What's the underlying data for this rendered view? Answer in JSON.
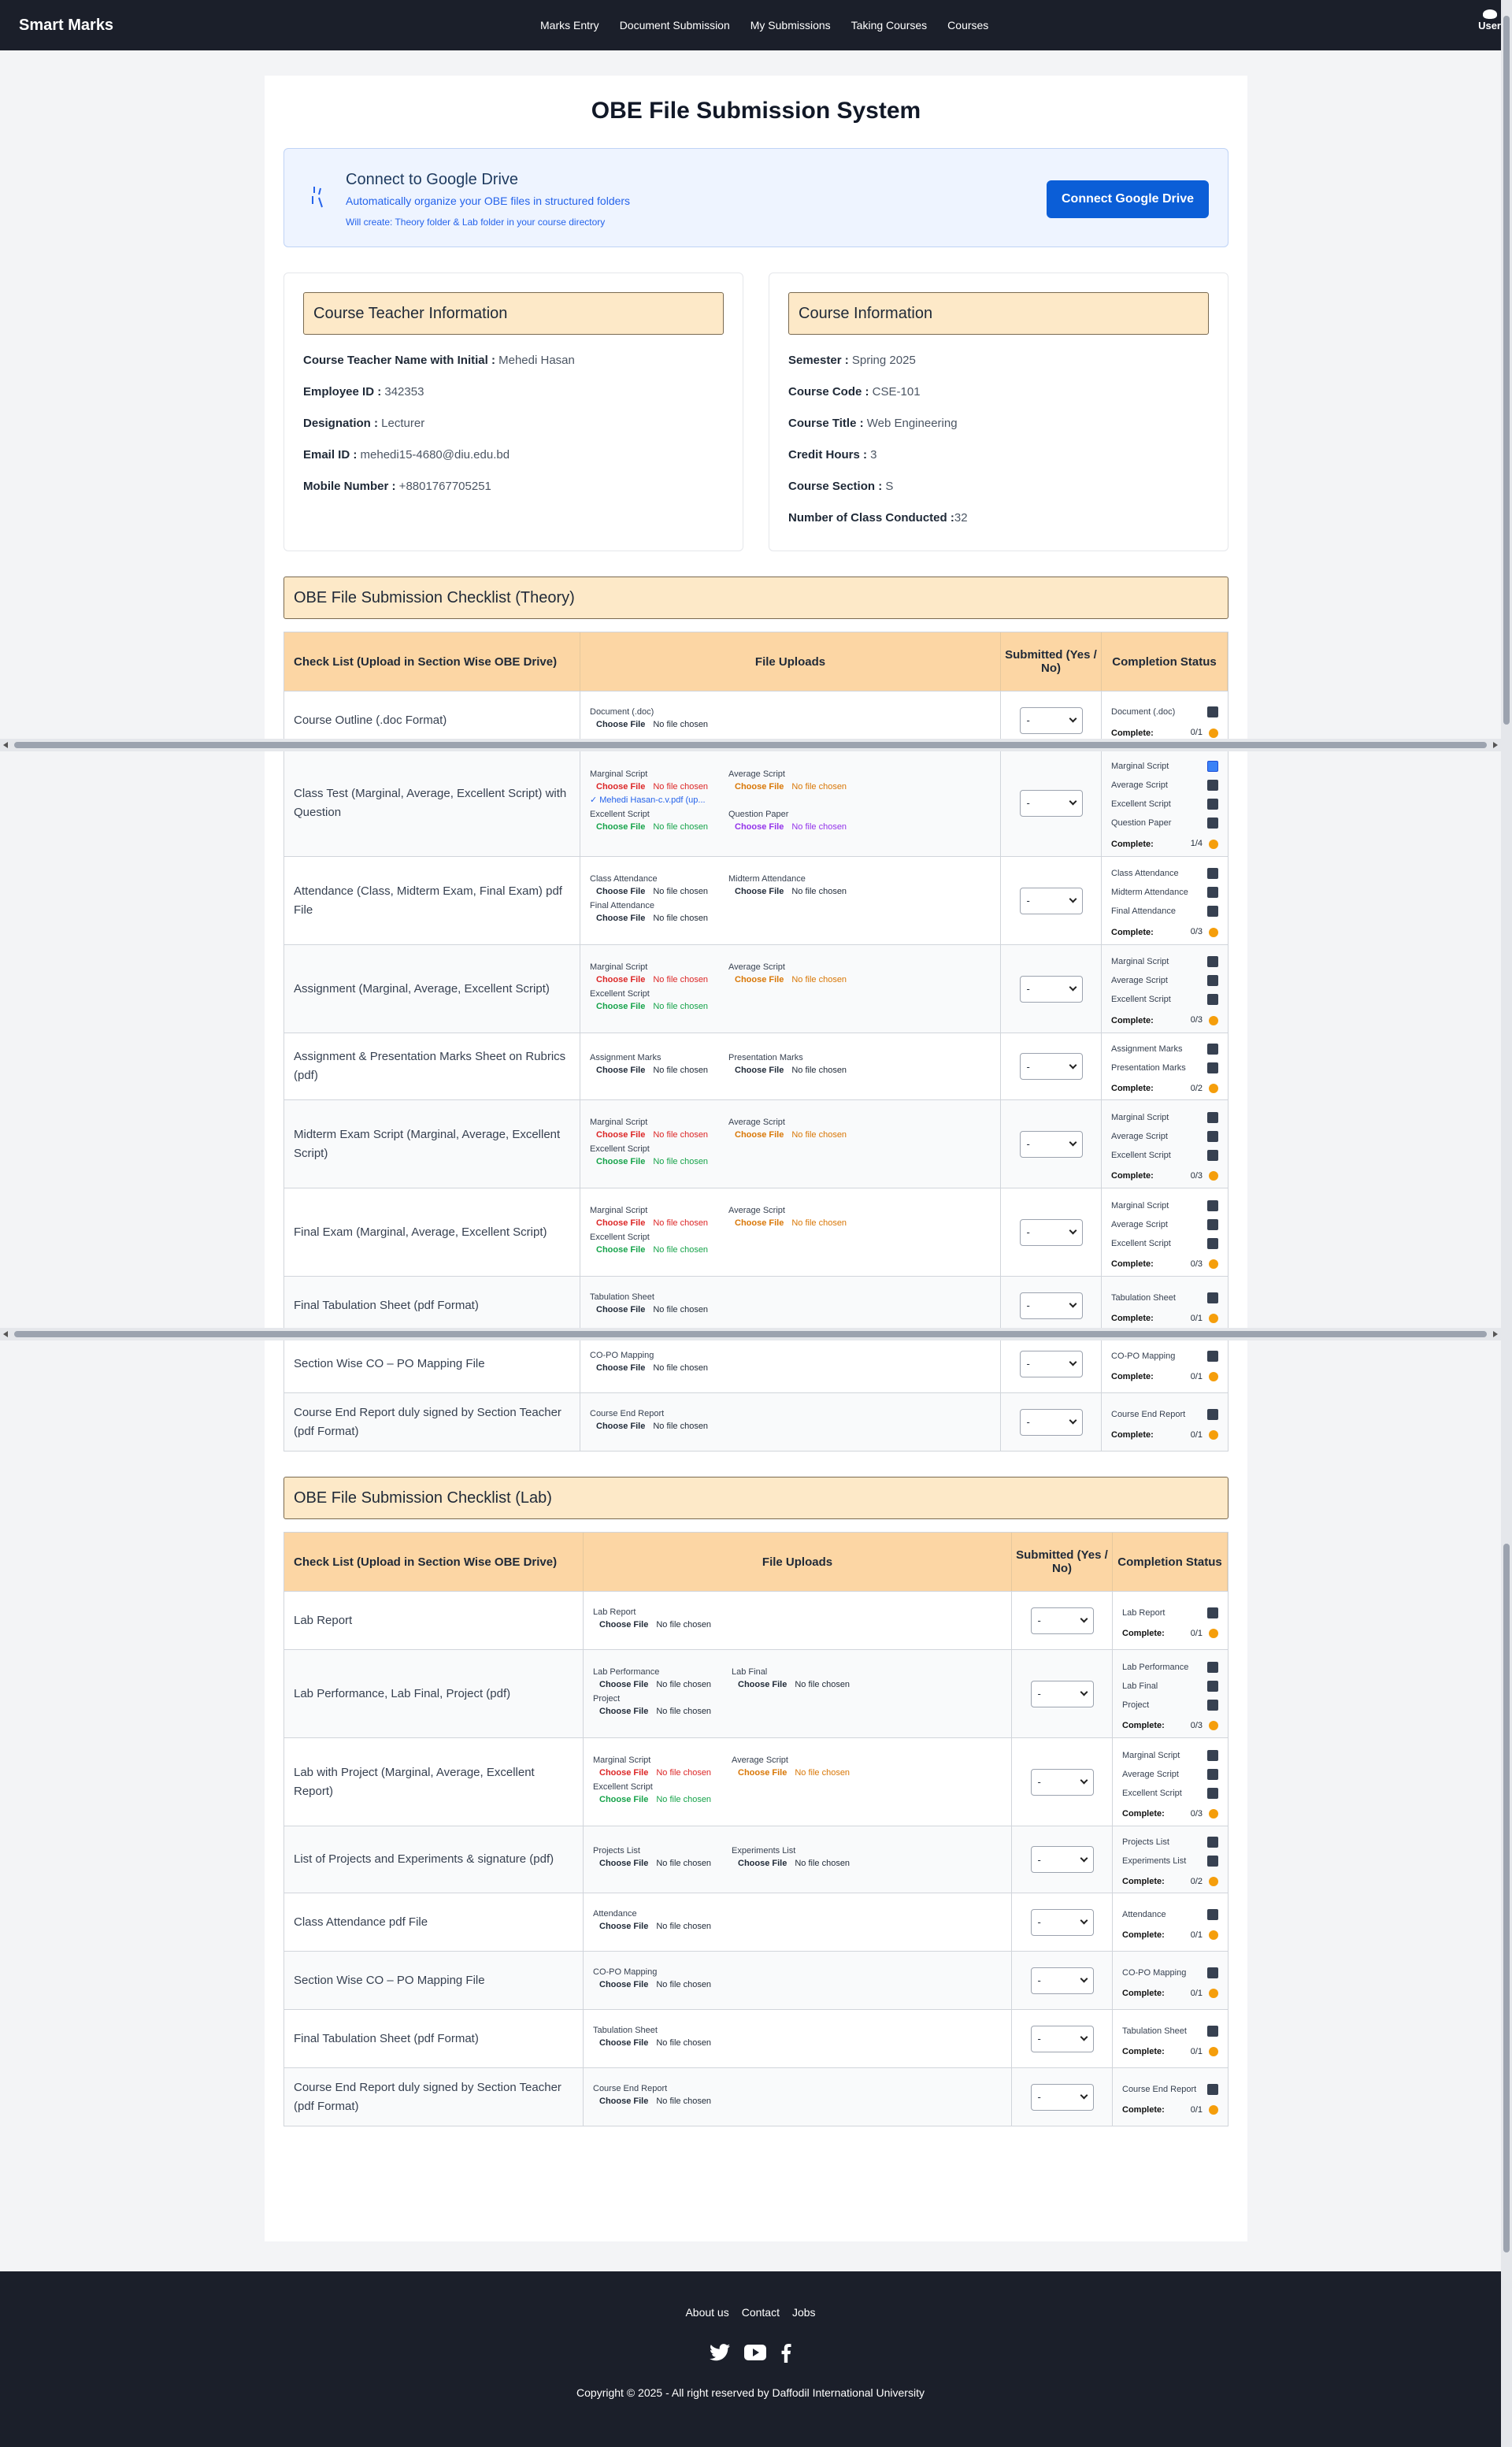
{
  "brand": "Smart Marks",
  "nav": [
    "Marks Entry",
    "Document Submission",
    "My Submissions",
    "Taking Courses",
    "Courses"
  ],
  "user": "User",
  "title": "OBE File Submission System",
  "gdrive": {
    "title": "Connect to Google Drive",
    "subtitle": "Automatically organize your OBE files in structured folders",
    "note": "Will create: Theory folder & Lab folder in your course directory",
    "button": "Connect Google Drive"
  },
  "teacher": {
    "heading": "Course Teacher Information",
    "rows": [
      {
        "label": "Course Teacher Name with Initial :",
        "value": " Mehedi Hasan"
      },
      {
        "label": "Employee ID :",
        "value": " 342353"
      },
      {
        "label": "Designation :",
        "value": " Lecturer"
      },
      {
        "label": "Email ID :",
        "value": " mehedi15-4680@diu.edu.bd"
      },
      {
        "label": "Mobile Number :",
        "value": " +8801767705251"
      }
    ]
  },
  "course": {
    "heading": "Course Information",
    "rows": [
      {
        "label": "Semester :",
        "value": " Spring 2025"
      },
      {
        "label": "Course Code :",
        "value": " CSE-101"
      },
      {
        "label": "Course Title :",
        "value": " Web Engineering"
      },
      {
        "label": "Credit Hours :",
        "value": " 3"
      },
      {
        "label": "Course Section :",
        "value": " S"
      },
      {
        "label": "Number of Class Conducted :",
        "value": "32"
      }
    ]
  },
  "theory": {
    "heading": "OBE File Submission Checklist (Theory)",
    "cols": [
      "Check List (Upload in Section Wise OBE Drive)",
      "File Uploads",
      "Submitted (Yes / No)",
      "Completion Status"
    ],
    "rows": [
      {
        "name": "Course Outline (.doc Format)",
        "files": [
          {
            "label": "Document (.doc)",
            "color": "blk"
          }
        ],
        "status": [
          {
            "label": "Document (.doc)",
            "on": false
          }
        ],
        "complete": "0/1"
      },
      {
        "name": "Class Test (Marginal, Average, Excellent Script) with Question",
        "files": [
          {
            "label": "Marginal Script",
            "color": "red",
            "uploaded": "✓ Mehedi Hasan-c.v.pdf (up..."
          },
          {
            "label": "Average Script",
            "color": "org"
          },
          {
            "label": "Excellent Script",
            "color": "grn"
          },
          {
            "label": "Question Paper",
            "color": "pur"
          }
        ],
        "status": [
          {
            "label": "Marginal Script",
            "on": true
          },
          {
            "label": "Average Script",
            "on": false
          },
          {
            "label": "Excellent Script",
            "on": false
          },
          {
            "label": "Question Paper",
            "on": false
          }
        ],
        "complete": "1/4"
      },
      {
        "name": "Attendance (Class, Midterm Exam, Final Exam) pdf File",
        "files": [
          {
            "label": "Class Attendance",
            "color": "blk"
          },
          {
            "label": "Midterm Attendance",
            "color": "blk"
          },
          {
            "label": "Final Attendance",
            "color": "blk"
          }
        ],
        "status": [
          {
            "label": "Class Attendance",
            "on": false
          },
          {
            "label": "Midterm Attendance",
            "on": false
          },
          {
            "label": "Final Attendance",
            "on": false
          }
        ],
        "complete": "0/3"
      },
      {
        "name": "Assignment (Marginal, Average, Excellent Script)",
        "files": [
          {
            "label": "Marginal Script",
            "color": "red"
          },
          {
            "label": "Average Script",
            "color": "org"
          },
          {
            "label": "Excellent Script",
            "color": "grn"
          }
        ],
        "status": [
          {
            "label": "Marginal Script",
            "on": false
          },
          {
            "label": "Average Script",
            "on": false
          },
          {
            "label": "Excellent Script",
            "on": false
          }
        ],
        "complete": "0/3"
      },
      {
        "name": "Assignment & Presentation Marks Sheet on Rubrics (pdf)",
        "files": [
          {
            "label": "Assignment Marks",
            "color": "blk"
          },
          {
            "label": "Presentation Marks",
            "color": "blk"
          }
        ],
        "status": [
          {
            "label": "Assignment Marks",
            "on": false
          },
          {
            "label": "Presentation Marks",
            "on": false
          }
        ],
        "complete": "0/2"
      },
      {
        "name": "Midterm Exam Script (Marginal, Average, Excellent Script)",
        "files": [
          {
            "label": "Marginal Script",
            "color": "red"
          },
          {
            "label": "Average Script",
            "color": "org"
          },
          {
            "label": "Excellent Script",
            "color": "grn"
          }
        ],
        "status": [
          {
            "label": "Marginal Script",
            "on": false
          },
          {
            "label": "Average Script",
            "on": false
          },
          {
            "label": "Excellent Script",
            "on": false
          }
        ],
        "complete": "0/3"
      },
      {
        "name": "Final Exam (Marginal, Average, Excellent Script)",
        "files": [
          {
            "label": "Marginal Script",
            "color": "red"
          },
          {
            "label": "Average Script",
            "color": "org"
          },
          {
            "label": "Excellent Script",
            "color": "grn"
          }
        ],
        "status": [
          {
            "label": "Marginal Script",
            "on": false
          },
          {
            "label": "Average Script",
            "on": false
          },
          {
            "label": "Excellent Script",
            "on": false
          }
        ],
        "complete": "0/3"
      },
      {
        "name": "Final Tabulation Sheet (pdf Format)",
        "files": [
          {
            "label": "Tabulation Sheet",
            "color": "blk"
          }
        ],
        "status": [
          {
            "label": "Tabulation Sheet",
            "on": false
          }
        ],
        "complete": "0/1"
      },
      {
        "name": "Section Wise CO – PO Mapping File",
        "files": [
          {
            "label": "CO-PO Mapping",
            "color": "blk"
          }
        ],
        "status": [
          {
            "label": "CO-PO Mapping",
            "on": false
          }
        ],
        "complete": "0/1"
      },
      {
        "name": "Course End Report duly signed by Section Teacher (pdf Format)",
        "files": [
          {
            "label": "Course End Report",
            "color": "blk"
          }
        ],
        "status": [
          {
            "label": "Course End Report",
            "on": false
          }
        ],
        "complete": "0/1"
      }
    ]
  },
  "lab": {
    "heading": "OBE File Submission Checklist (Lab)",
    "cols": [
      "Check List (Upload in Section Wise OBE Drive)",
      "File Uploads",
      "Submitted (Yes / No)",
      "Completion Status"
    ],
    "rows": [
      {
        "name": "Lab Report",
        "files": [
          {
            "label": "Lab Report",
            "color": "blk"
          }
        ],
        "status": [
          {
            "label": "Lab Report",
            "on": false
          }
        ],
        "complete": "0/1"
      },
      {
        "name": "Lab Performance, Lab Final, Project (pdf)",
        "files": [
          {
            "label": "Lab Performance",
            "color": "blk"
          },
          {
            "label": "Lab Final",
            "color": "blk"
          },
          {
            "label": "Project",
            "color": "blk"
          }
        ],
        "status": [
          {
            "label": "Lab Performance",
            "on": false
          },
          {
            "label": "Lab Final",
            "on": false
          },
          {
            "label": "Project",
            "on": false
          }
        ],
        "complete": "0/3"
      },
      {
        "name": "Lab with Project (Marginal, Average, Excellent Report)",
        "files": [
          {
            "label": "Marginal Script",
            "color": "red"
          },
          {
            "label": "Average Script",
            "color": "org"
          },
          {
            "label": "Excellent Script",
            "color": "grn"
          }
        ],
        "status": [
          {
            "label": "Marginal Script",
            "on": false
          },
          {
            "label": "Average Script",
            "on": false
          },
          {
            "label": "Excellent Script",
            "on": false
          }
        ],
        "complete": "0/3"
      },
      {
        "name": "List of Projects and Experiments & signature (pdf)",
        "files": [
          {
            "label": "Projects List",
            "color": "blk"
          },
          {
            "label": "Experiments List",
            "color": "blk"
          }
        ],
        "status": [
          {
            "label": "Projects List",
            "on": false
          },
          {
            "label": "Experiments List",
            "on": false
          }
        ],
        "complete": "0/2"
      },
      {
        "name": "Class Attendance pdf File",
        "files": [
          {
            "label": "Attendance",
            "color": "blk"
          }
        ],
        "status": [
          {
            "label": "Attendance",
            "on": false
          }
        ],
        "complete": "0/1"
      },
      {
        "name": "Section Wise CO – PO Mapping File",
        "files": [
          {
            "label": "CO-PO Mapping",
            "color": "blk"
          }
        ],
        "status": [
          {
            "label": "CO-PO Mapping",
            "on": false
          }
        ],
        "complete": "0/1"
      },
      {
        "name": "Final Tabulation Sheet (pdf Format)",
        "files": [
          {
            "label": "Tabulation Sheet",
            "color": "blk"
          }
        ],
        "status": [
          {
            "label": "Tabulation Sheet",
            "on": false
          }
        ],
        "complete": "0/1"
      },
      {
        "name": "Course End Report duly signed by Section Teacher (pdf Format)",
        "files": [
          {
            "label": "Course End Report",
            "color": "blk"
          }
        ],
        "status": [
          {
            "label": "Course End Report",
            "on": false
          }
        ],
        "complete": "0/1"
      }
    ]
  },
  "upload": {
    "choose": "Choose File",
    "none": "No file chosen"
  },
  "select_value": "-",
  "complete_label": "Complete:",
  "footer": {
    "links": [
      "About us",
      "Contact",
      "Jobs"
    ],
    "icons": [
      "twitter-icon",
      "youtube-icon",
      "facebook-icon"
    ],
    "copyright": "Copyright © 2025 - All right reserved by Daffodil International University"
  }
}
